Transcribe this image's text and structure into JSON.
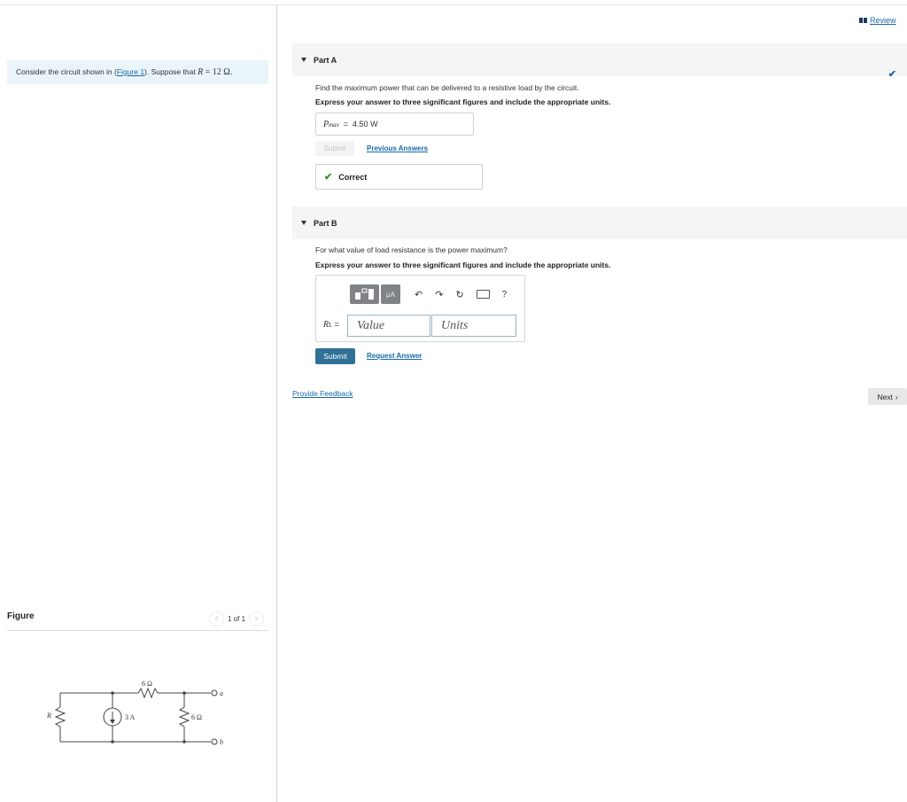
{
  "problem": {
    "intro_prefix": "Consider the circuit shown in (",
    "figure_link": "Figure 1",
    "intro_middle": "). Suppose that ",
    "r_symbol": "R",
    "r_value": " = 12 Ω."
  },
  "figure": {
    "title": "Figure",
    "pager": "1 of 1",
    "prev_glyph": "‹",
    "next_glyph": "›",
    "circuit_labels": {
      "r_top": "6 Ω",
      "source": "3 A",
      "r_right": "6 Ω",
      "r_left": "R",
      "node_a": "a",
      "node_b": "b"
    }
  },
  "header": {
    "review_label": "Review"
  },
  "part_a": {
    "label": "Part A",
    "question": "Find the maximum power that can be delivered to a resistive load by the circuit.",
    "instruction": "Express your answer to three significant figures and include the appropriate units.",
    "answer_symbol": "P",
    "answer_sub": "max",
    "answer_eq": "=",
    "answer_value": "4.50 W",
    "submit_label": "Submit",
    "previous_answers_label": "Previous Answers",
    "result_label": "Correct"
  },
  "part_b": {
    "label": "Part B",
    "question": "For what value of load resistance is the power maximum?",
    "instruction": "Express your answer to three significant figures and include the appropriate units.",
    "toolbar": {
      "units_btn": "μA",
      "help": "?"
    },
    "input_symbol": "R",
    "input_sub": "L",
    "input_eq": "=",
    "value_placeholder": "Value",
    "units_placeholder": "Units",
    "submit_label": "Submit",
    "request_answer_label": "Request Answer"
  },
  "footer": {
    "feedback_label": "Provide Feedback",
    "next_label": "Next"
  }
}
